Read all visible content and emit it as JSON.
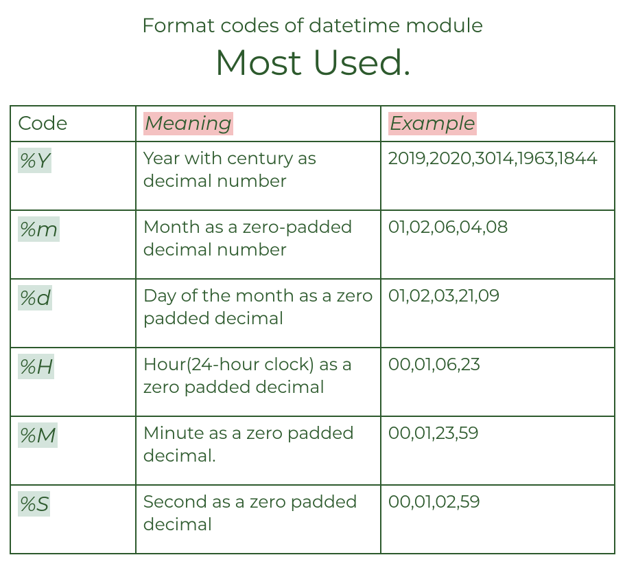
{
  "header": {
    "subtitle": "Format codes of datetime module",
    "title": "Most Used."
  },
  "table": {
    "headers": {
      "code": "Code",
      "meaning": "Meaning",
      "example": "Example"
    },
    "rows": [
      {
        "code": "%Y",
        "meaning": "Year with century as decimal number",
        "example": "2019,2020,3014,1963,1844"
      },
      {
        "code": "%m",
        "meaning": "Month as a zero-padded decimal number",
        "example": "01,02,06,04,08"
      },
      {
        "code": "%d",
        "meaning": "Day of the month as a zero padded decimal",
        "example": "01,02,03,21,09"
      },
      {
        "code": "%H",
        "meaning": "Hour(24-hour clock) as a zero padded decimal",
        "example": "00,01,06,23"
      },
      {
        "code": "%M",
        "meaning": "Minute as a zero padded decimal.",
        "example": "00,01,23,59"
      },
      {
        "code": "%S",
        "meaning": "Second as a zero padded decimal",
        "example": "00,01,02,59"
      }
    ]
  }
}
